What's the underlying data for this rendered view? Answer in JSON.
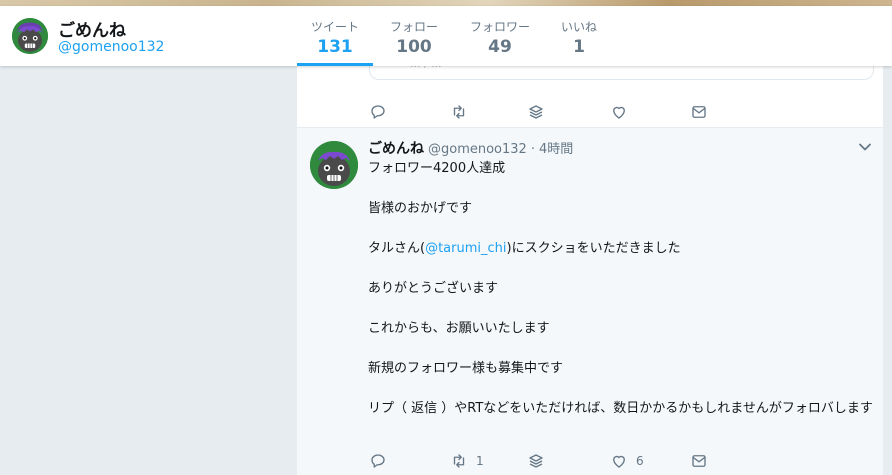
{
  "profile": {
    "name": "ごめんね",
    "handle": "@gomenoo132"
  },
  "stats": [
    {
      "label": "ツイート",
      "value": "131",
      "active": true
    },
    {
      "label": "フォロー",
      "value": "100",
      "active": false
    },
    {
      "label": "フォロワー",
      "value": "49",
      "active": false
    },
    {
      "label": "いいね",
      "value": "1",
      "active": false
    }
  ],
  "prev_tweet": {
    "reply_hint": "... / ..."
  },
  "tweet": {
    "name": "ごめんね",
    "handle": "@gomenoo132",
    "dot": "·",
    "time": "4時間",
    "lines": {
      "l1": "フォロワー4200人達成",
      "l2": "皆様のおかげです",
      "l3_pre": "タルさん(",
      "l3_mention": "@tarumi_chi",
      "l3_post": ")にスクショをいただきました",
      "l4": "ありがとうございます",
      "l5": "これからも、お願いいたします",
      "l6": "新規のフォロワー様も募集中です",
      "l7": "リプ（ 返信 ）やRTなどをいただければ、数日かかるかもしれませんがフォロバします"
    },
    "actions": {
      "retweet_count": "1",
      "like_count": "6"
    }
  },
  "colors": {
    "accent": "#1da1f2",
    "muted": "#657786",
    "background": "#e6ecf0"
  },
  "icons": [
    "reply-icon",
    "retweet-icon",
    "stack-icon",
    "like-icon",
    "message-icon",
    "chevron-down-icon"
  ]
}
